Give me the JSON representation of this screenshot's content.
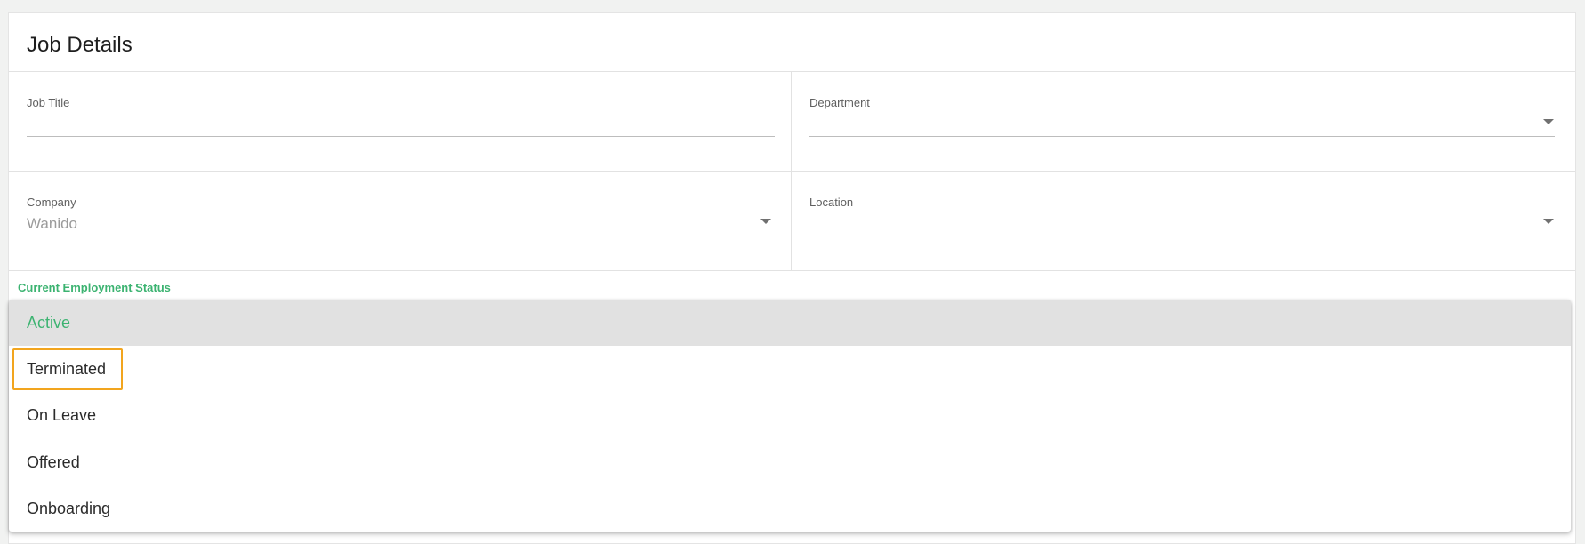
{
  "card": {
    "title": "Job Details"
  },
  "fields": {
    "job_title": {
      "label": "Job Title",
      "value": ""
    },
    "department": {
      "label": "Department",
      "value": ""
    },
    "company": {
      "label": "Company",
      "value": "Wanido"
    },
    "location": {
      "label": "Location",
      "value": ""
    },
    "employment_status": {
      "label": "Current Employment Status"
    }
  },
  "status_menu": {
    "options": [
      "Active",
      "Terminated",
      "On Leave",
      "Offered",
      "Onboarding"
    ],
    "selected": "Active",
    "focused": "Terminated"
  },
  "colors": {
    "accent": "#3cb371",
    "focus_outline": "#f2a51e",
    "selected_bg": "#e1e1e1"
  },
  "icons": {
    "dropdown": "chevron-down-icon"
  }
}
